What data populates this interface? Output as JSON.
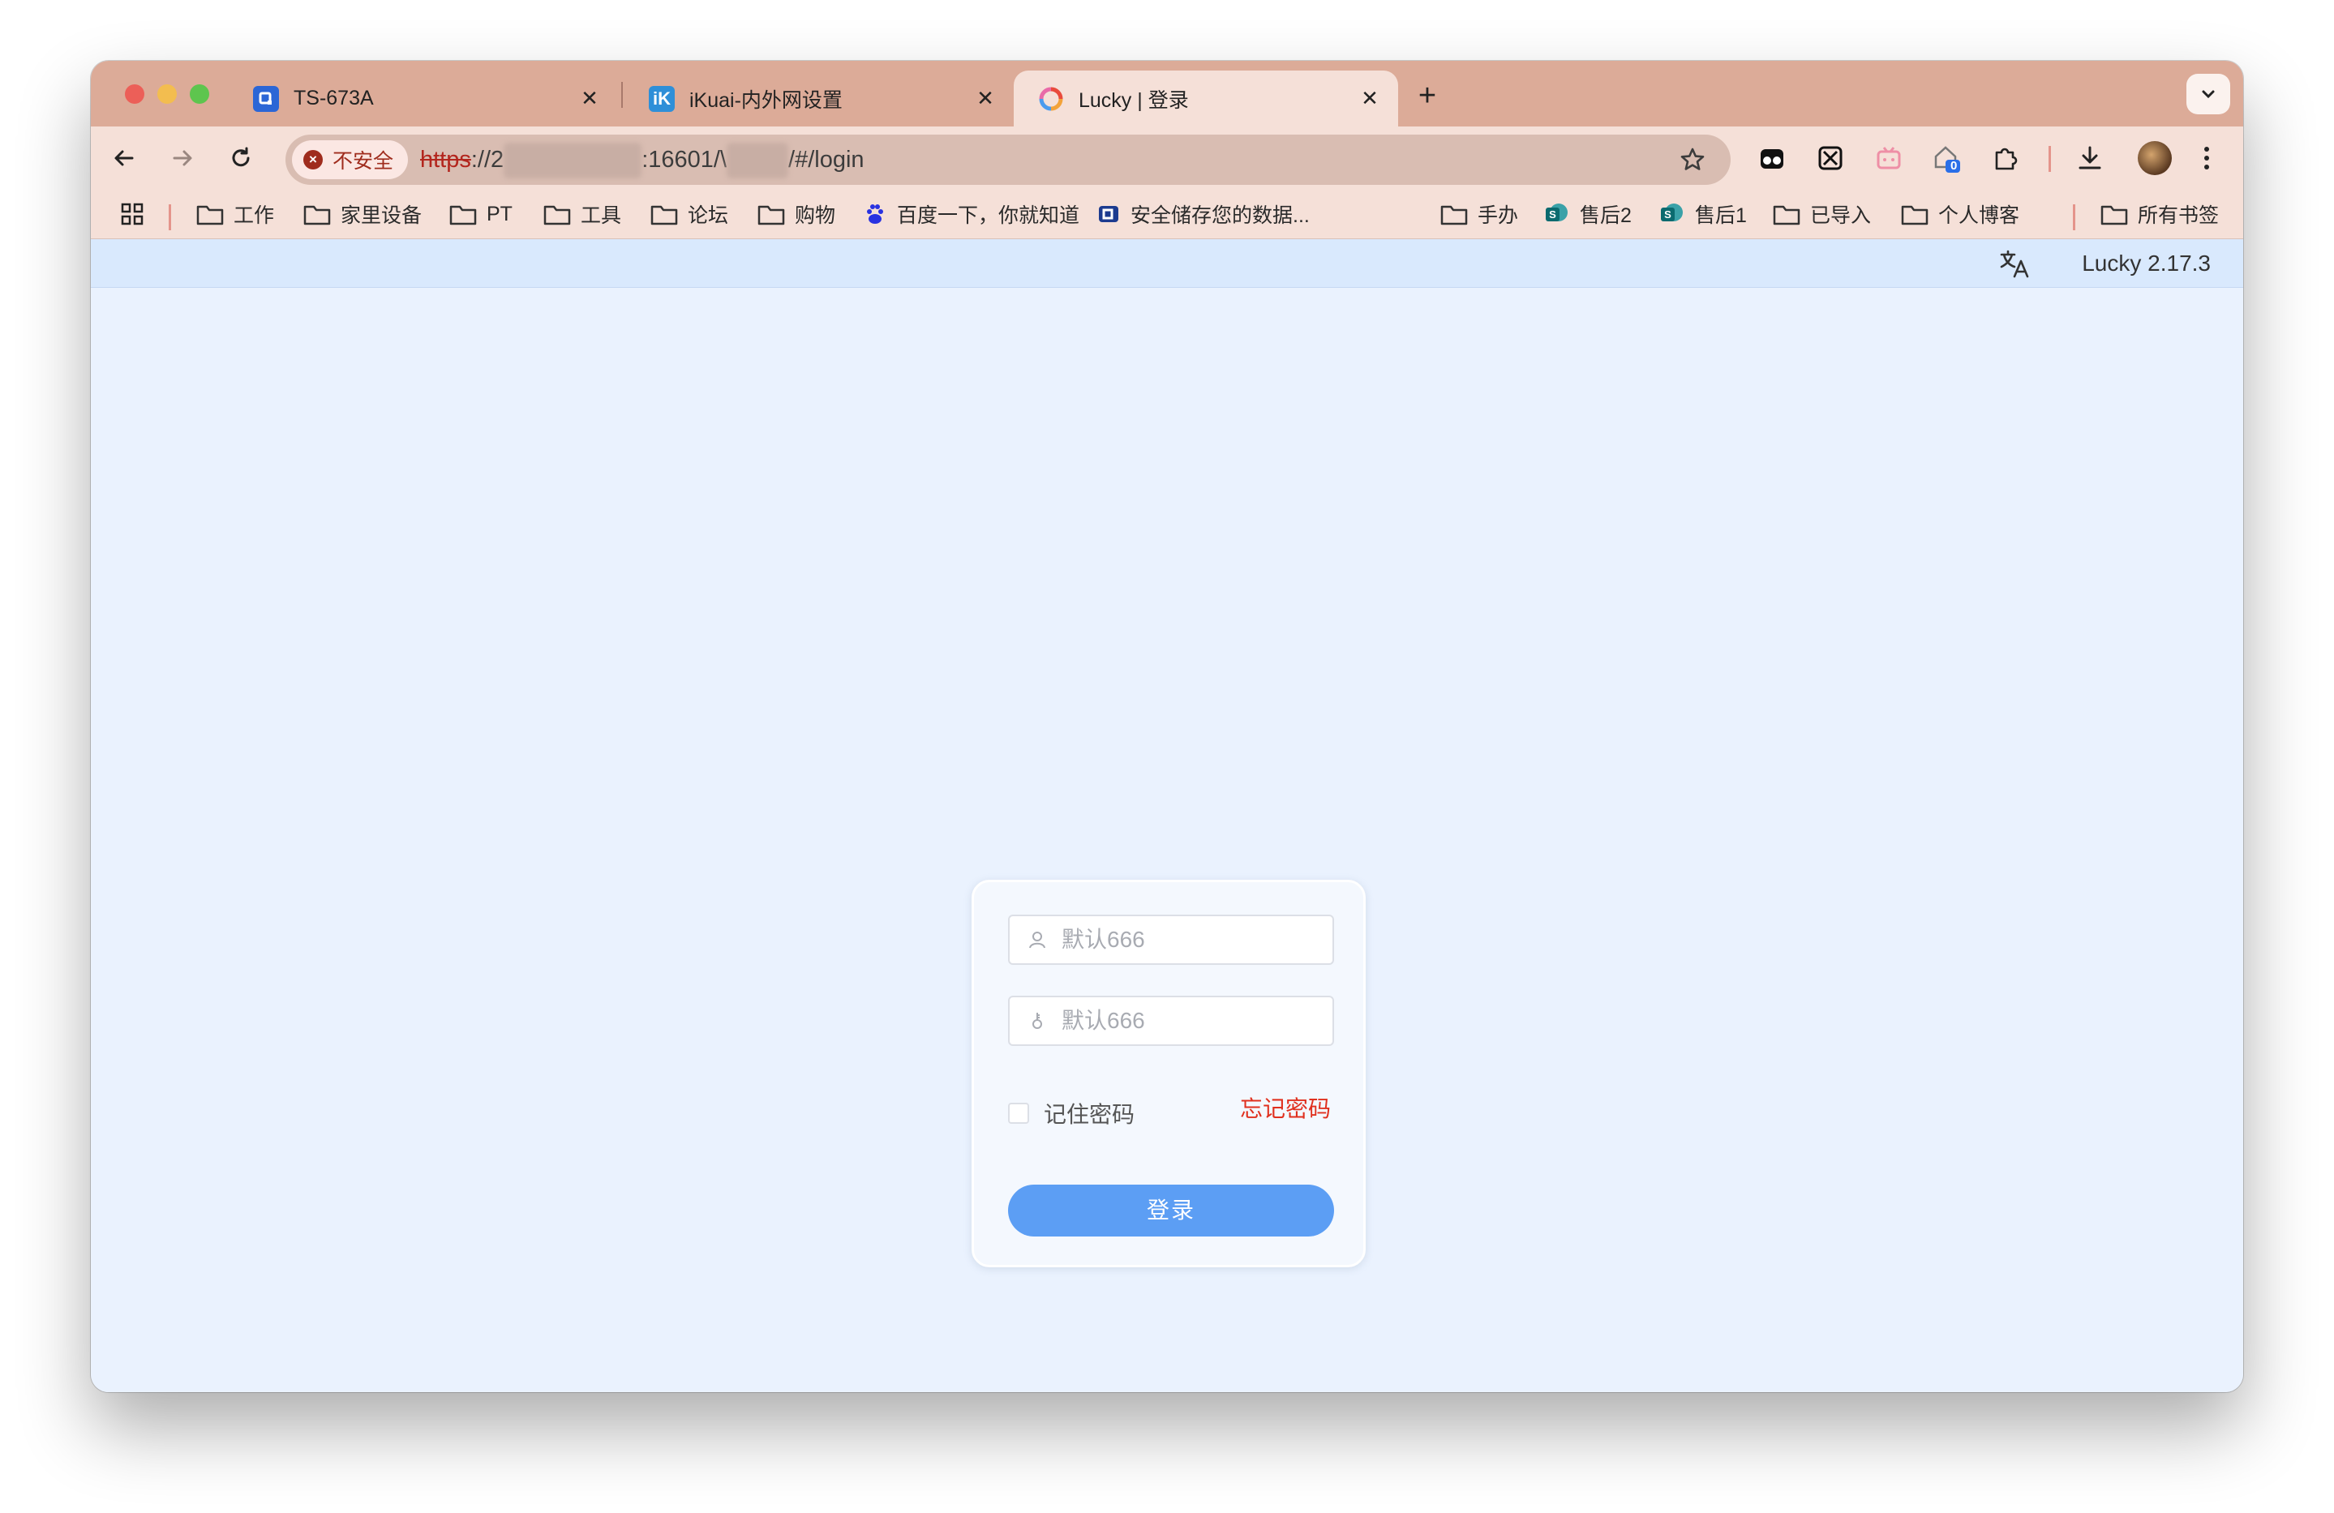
{
  "browser": {
    "tabs": [
      {
        "title": "TS-673A",
        "close": "✕"
      },
      {
        "title": "iKuai-内外网设置",
        "close": "✕"
      },
      {
        "title": "Lucky | 登录",
        "close": "✕"
      }
    ],
    "new_tab": "+",
    "security_label": "不安全",
    "url": {
      "scheme": "https",
      "mid1": "://2",
      "port_path": ":16601/\\",
      "tail": "/#/login"
    },
    "extension_badge": "0",
    "icons": [
      "back-icon",
      "forward-icon",
      "reload-icon",
      "star-icon",
      "download-icon",
      "more-icon",
      "apps-icon",
      "folder-icon",
      "translate-icon"
    ]
  },
  "bookmarks": [
    {
      "label": "工作",
      "type": "folder"
    },
    {
      "label": "家里设备",
      "type": "folder"
    },
    {
      "label": "PT",
      "type": "folder"
    },
    {
      "label": "工具",
      "type": "folder"
    },
    {
      "label": "论坛",
      "type": "folder"
    },
    {
      "label": "购物",
      "type": "folder"
    },
    {
      "label": "百度一下，你就知道",
      "type": "site"
    },
    {
      "label": "安全储存您的数据...",
      "type": "site"
    },
    {
      "label": "手办",
      "type": "folder"
    },
    {
      "label": "售后2",
      "type": "site"
    },
    {
      "label": "售后1",
      "type": "site"
    },
    {
      "label": "已导入",
      "type": "folder"
    },
    {
      "label": "个人博客",
      "type": "folder"
    },
    {
      "label": "所有书签",
      "type": "folder"
    }
  ],
  "app": {
    "version": "Lucky 2.17.3",
    "login": {
      "username_placeholder": "默认666",
      "password_placeholder": "默认666",
      "remember_label": "记住密码",
      "forgot_label": "忘记密码",
      "submit_label": "登录"
    }
  },
  "colors": {
    "tab_strip": "#dcab98",
    "toolbar": "#f5e0d8",
    "page_bg": "#eaf2fe",
    "primary_button": "#5c9ef4",
    "danger_link": "#e0301e"
  }
}
